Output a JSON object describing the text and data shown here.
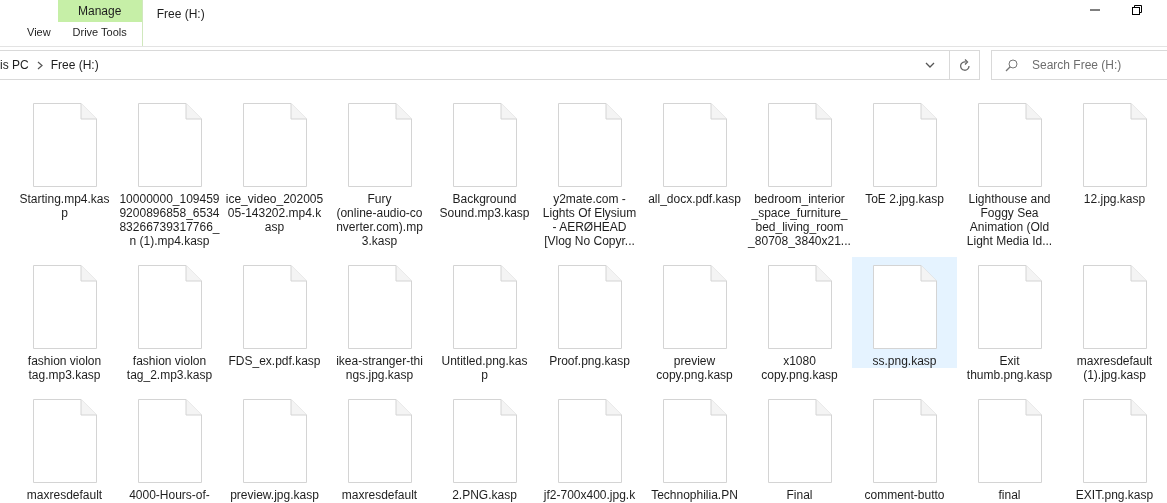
{
  "ribbon": {
    "tabs": [
      {
        "label": "View",
        "kind": "plain",
        "selected": false
      },
      {
        "label": "Drive Tools",
        "kind": "contextual",
        "group": "Manage",
        "selected": false
      }
    ]
  },
  "window": {
    "title": "Free (H:)"
  },
  "address_bar": {
    "crumbs": [
      "is PC",
      "Free (H:)"
    ]
  },
  "search": {
    "placeholder": "Search Free (H:)"
  },
  "files": [
    {
      "lines": [
        "Starting.mp4.kas",
        "p"
      ],
      "selected": false
    },
    {
      "lines": [
        "10000000_109459",
        "9200896858_6534",
        "83266739317766_",
        "n (1).mp4.kasp"
      ],
      "selected": false
    },
    {
      "lines": [
        "ice_video_202005",
        "05-143202.mp4.k",
        "asp"
      ],
      "selected": false
    },
    {
      "lines": [
        "Fury",
        "(online-audio-co",
        "nverter.com).mp",
        "3.kasp"
      ],
      "selected": false
    },
    {
      "lines": [
        "Background",
        "Sound.mp3.kasp"
      ],
      "selected": false
    },
    {
      "lines": [
        "y2mate.com -",
        "Lights Of Elysium",
        "- AERØHEAD",
        "[Vlog No Copyr..."
      ],
      "selected": false
    },
    {
      "lines": [
        "all_docx.pdf.kasp"
      ],
      "selected": false
    },
    {
      "lines": [
        "bedroom_interior",
        "_space_furniture_",
        "bed_living_room",
        "_80708_3840x21..."
      ],
      "selected": false
    },
    {
      "lines": [
        "ToE 2.jpg.kasp"
      ],
      "selected": false
    },
    {
      "lines": [
        "Lighthouse and",
        "Foggy Sea",
        "Animation (Old",
        "Light Media Id..."
      ],
      "selected": false
    },
    {
      "lines": [
        "12.jpg.kasp"
      ],
      "selected": false
    },
    {
      "lines": [
        "fashion violon",
        "tag.mp3.kasp"
      ],
      "selected": false
    },
    {
      "lines": [
        "fashion violon",
        "tag_2.mp3.kasp"
      ],
      "selected": false
    },
    {
      "lines": [
        "FDS_ex.pdf.kasp"
      ],
      "selected": false
    },
    {
      "lines": [
        "ikea-stranger-thi",
        "ngs.jpg.kasp"
      ],
      "selected": false
    },
    {
      "lines": [
        "Untitled.png.kas",
        "p"
      ],
      "selected": false
    },
    {
      "lines": [
        "Proof.png.kasp"
      ],
      "selected": false
    },
    {
      "lines": [
        "preview",
        "copy.png.kasp"
      ],
      "selected": false
    },
    {
      "lines": [
        "x1080",
        "copy.png.kasp"
      ],
      "selected": false
    },
    {
      "lines": [
        "ss.png.kasp"
      ],
      "selected": true
    },
    {
      "lines": [
        "Exit",
        "thumb.png.kasp"
      ],
      "selected": false
    },
    {
      "lines": [
        "maxresdefault",
        "(1).jpg.kasp"
      ],
      "selected": false
    },
    {
      "lines": [
        "maxresdefault"
      ],
      "selected": false
    },
    {
      "lines": [
        "4000-Hours-of-"
      ],
      "selected": false
    },
    {
      "lines": [
        "preview.jpg.kasp"
      ],
      "selected": false
    },
    {
      "lines": [
        "maxresdefault"
      ],
      "selected": false
    },
    {
      "lines": [
        "2.PNG.kasp"
      ],
      "selected": false
    },
    {
      "lines": [
        "jf2-700x400.jpg.k"
      ],
      "selected": false
    },
    {
      "lines": [
        "Technophilia.PN"
      ],
      "selected": false
    },
    {
      "lines": [
        "Final"
      ],
      "selected": false
    },
    {
      "lines": [
        "comment-butto"
      ],
      "selected": false
    },
    {
      "lines": [
        "final"
      ],
      "selected": false
    },
    {
      "lines": [
        "EXIT.png.kasp"
      ],
      "selected": false
    }
  ]
}
